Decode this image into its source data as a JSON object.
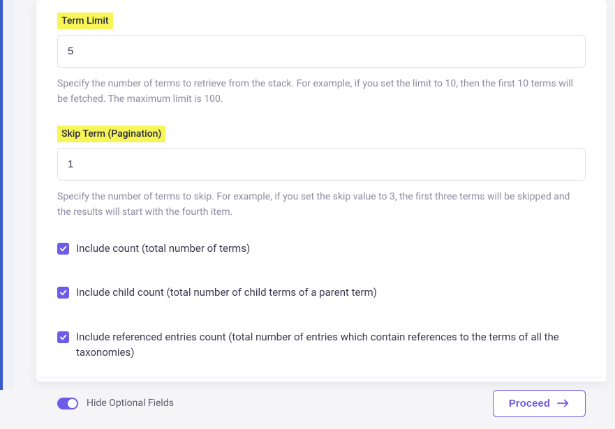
{
  "form": {
    "term_limit": {
      "label": "Term Limit",
      "value": "5",
      "helper": "Specify the number of terms to retrieve from the stack. For example, if you set the limit to 10, then the first 10 terms will be fetched. The maximum limit is 100."
    },
    "skip_term": {
      "label": "Skip Term (Pagination)",
      "value": "1",
      "helper": "Specify the number of terms to skip. For example, if you set the skip value to 3, the first three terms will be skipped and the results will start with the fourth item."
    },
    "checkboxes": {
      "include_count": {
        "label": "Include count (total number of terms)",
        "checked": true
      },
      "include_child_count": {
        "label": "Include child count (total number of child terms of a parent term)",
        "checked": true
      },
      "include_ref_count": {
        "label": "Include referenced entries count (total number of entries which contain references to the terms of all the taxonomies)",
        "checked": true
      }
    }
  },
  "footer": {
    "toggle_label": "Hide Optional Fields",
    "proceed_label": "Proceed"
  }
}
